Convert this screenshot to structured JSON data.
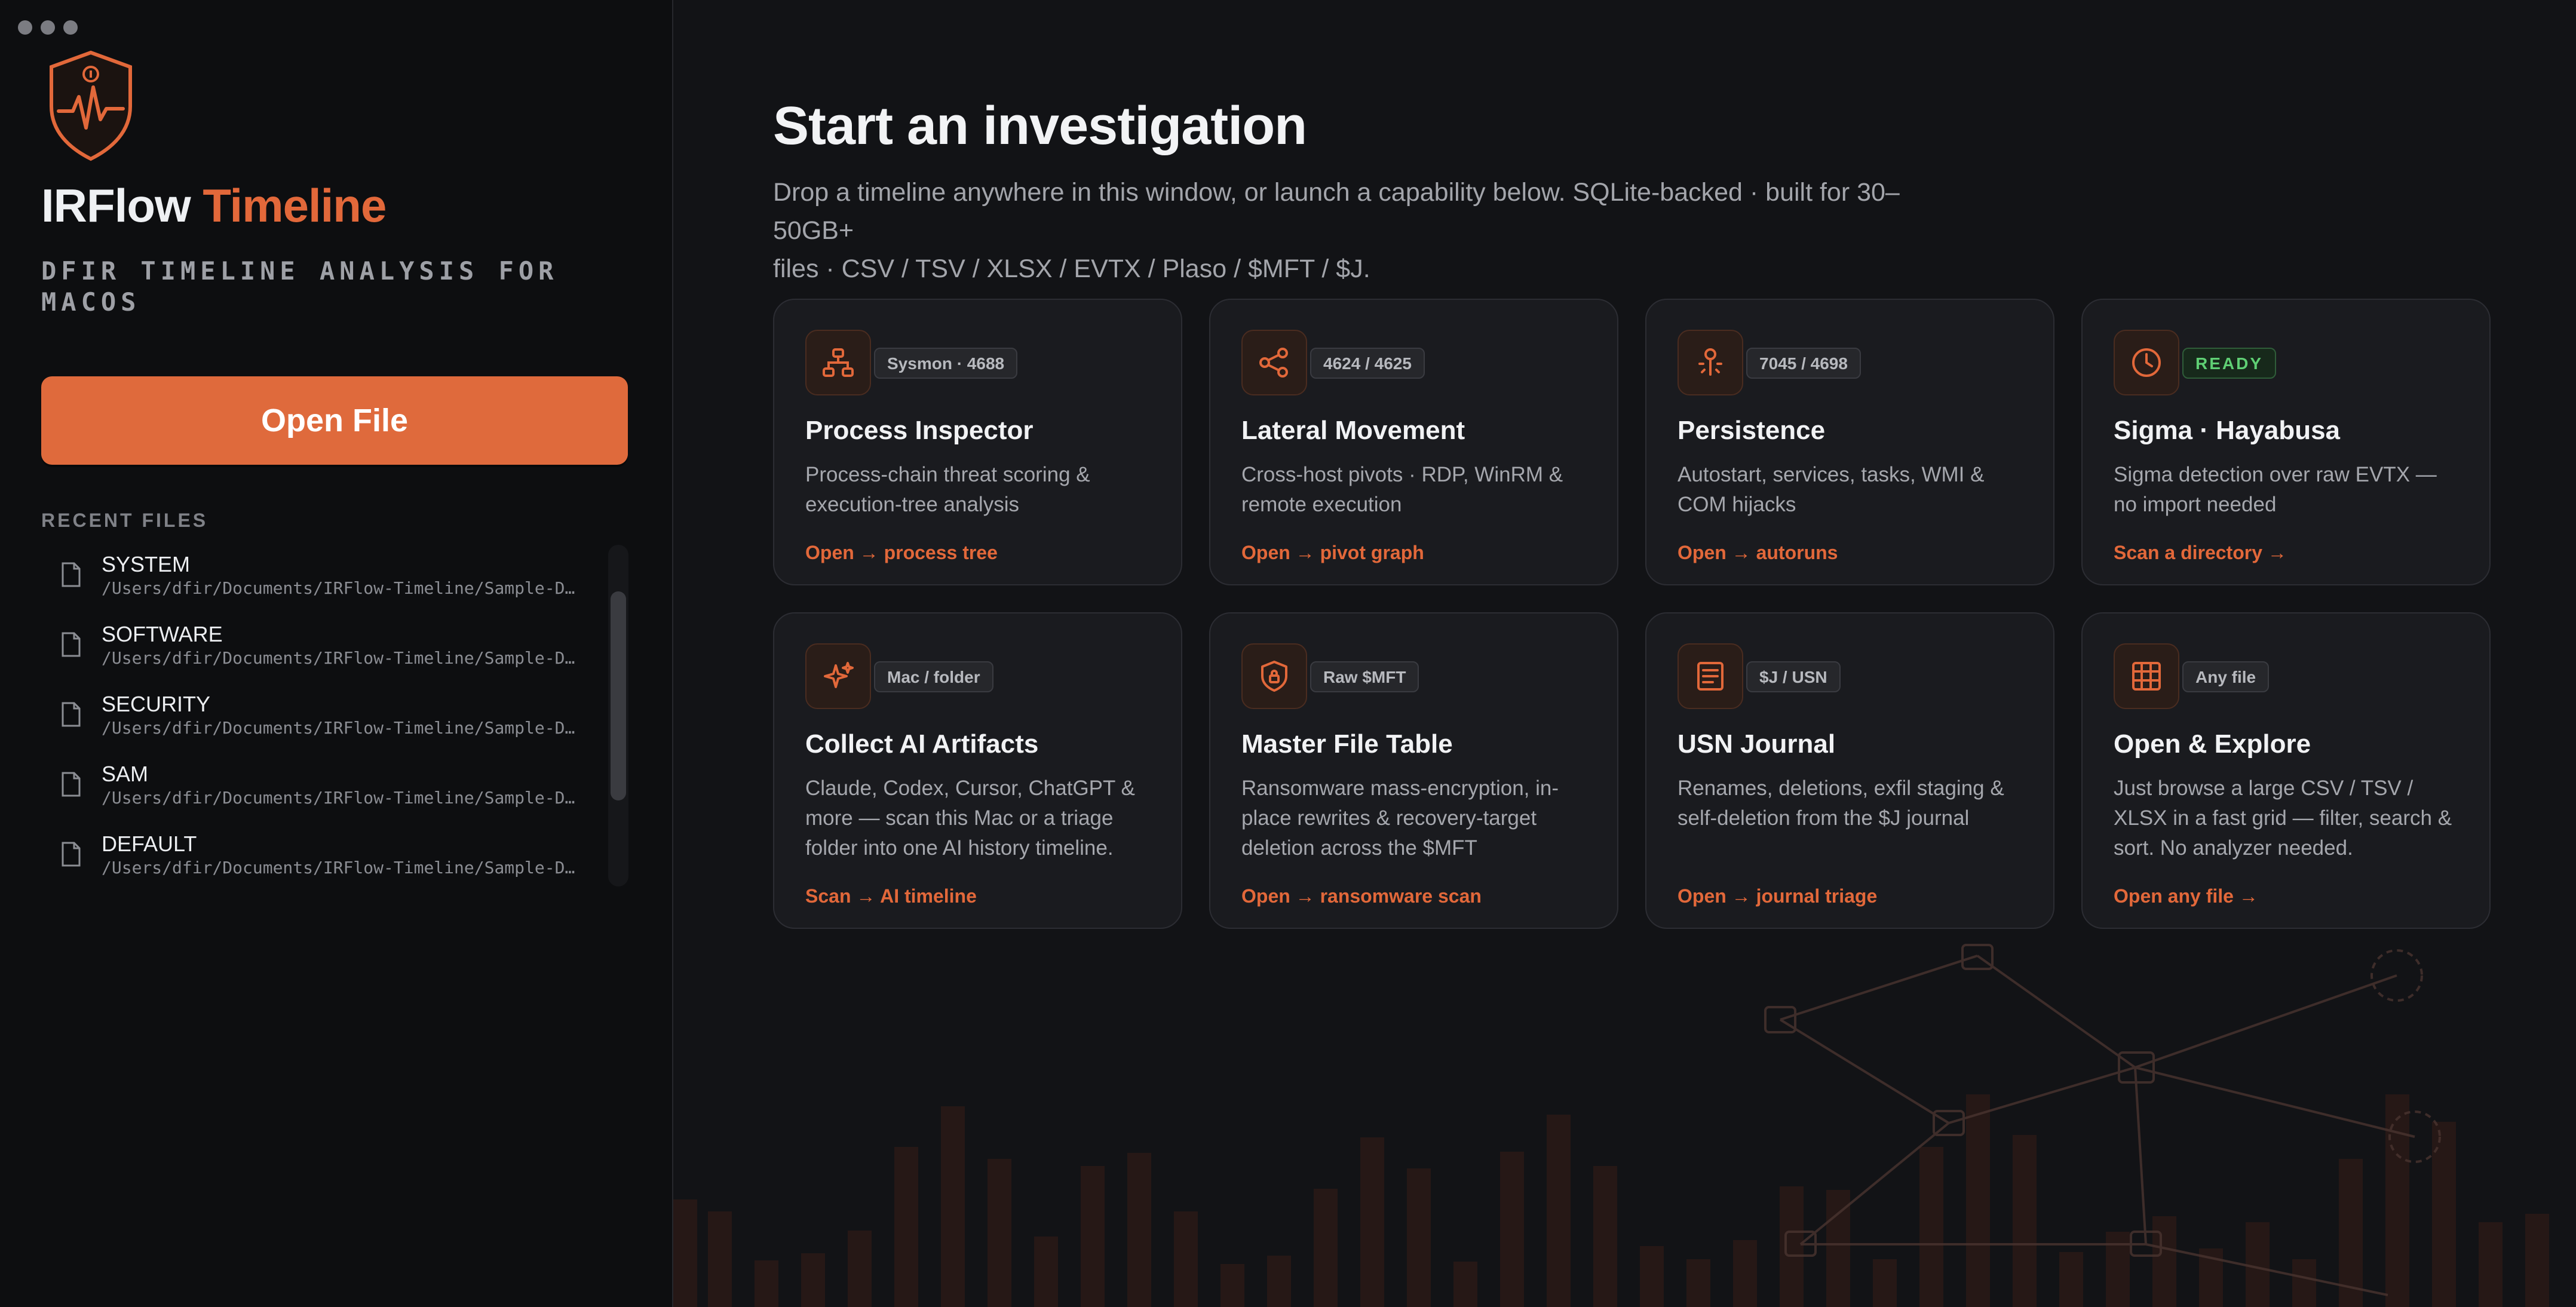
{
  "window": {
    "controls": [
      "close",
      "minimize",
      "zoom"
    ]
  },
  "sidebar": {
    "brand_part1": "IRFlow",
    "brand_part2": "Timeline",
    "tagline": "DFIR TIMELINE ANALYSIS FOR MACOS",
    "open_button": "Open File",
    "recent_label": "RECENT FILES",
    "recent_files": [
      {
        "name": "SYSTEM",
        "path": "/Users/dfir/Documents/IRFlow-Timeline/Sample-D…"
      },
      {
        "name": "SOFTWARE",
        "path": "/Users/dfir/Documents/IRFlow-Timeline/Sample-D…"
      },
      {
        "name": "SECURITY",
        "path": "/Users/dfir/Documents/IRFlow-Timeline/Sample-D…"
      },
      {
        "name": "SAM",
        "path": "/Users/dfir/Documents/IRFlow-Timeline/Sample-D…"
      },
      {
        "name": "DEFAULT",
        "path": "/Users/dfir/Documents/IRFlow-Timeline/Sample-D…"
      }
    ]
  },
  "main": {
    "headline": "Start an investigation",
    "intro_line1": "Drop a timeline anywhere in this window, or launch a capability below. SQLite-backed · built for 30–50GB+",
    "intro_line2": "files · CSV / TSV / XLSX / EVTX / Plaso / $MFT / $J.",
    "cards": [
      {
        "icon": "process-tree-icon",
        "badge": "Sysmon · 4688",
        "title": "Process Inspector",
        "desc": "Process-chain threat scoring & execution-tree analysis",
        "link": "Open → process tree"
      },
      {
        "icon": "share-nodes-icon",
        "badge": "4624 / 4625",
        "title": "Lateral Movement",
        "desc": "Cross-host pivots · RDP, WinRM & remote execution",
        "link": "Open → pivot graph"
      },
      {
        "icon": "anchor-pin-icon",
        "badge": "7045 / 4698",
        "title": "Persistence",
        "desc": "Autostart, services, tasks, WMI & COM hijacks",
        "link": "Open → autoruns"
      },
      {
        "icon": "clock-icon",
        "badge": "READY",
        "title": "Sigma · Hayabusa",
        "desc": "Sigma detection over raw EVTX — no import needed",
        "link": "Scan a directory →"
      },
      {
        "icon": "sparkle-icon",
        "badge": "Mac / folder",
        "title": "Collect AI Artifacts",
        "desc": "Claude, Codex, Cursor, ChatGPT & more — scan this Mac or a triage folder into one AI history timeline.",
        "link": "Scan → AI timeline"
      },
      {
        "icon": "shield-lock-icon",
        "badge": "Raw $MFT",
        "title": "Master File Table",
        "desc": "Ransomware mass-encryption, in-place rewrites & recovery-target deletion across the $MFT",
        "link": "Open → ransomware scan"
      },
      {
        "icon": "journal-icon",
        "badge": "$J / USN",
        "title": "USN Journal",
        "desc": "Renames, deletions, exfil staging & self-deletion from the $J journal",
        "link": "Open → journal triage"
      },
      {
        "icon": "table-grid-icon",
        "badge": "Any file",
        "title": "Open & Explore",
        "desc": "Just browse a large CSV / TSV / XLSX in a fast grid — filter, search & sort. No analyzer needed.",
        "link": "Open any file →"
      }
    ]
  },
  "colors": {
    "accent": "#e2683a",
    "ready": "#5fcf74",
    "background": "#121316",
    "sidebar": "#0d0e10",
    "card": "#1a1b1f"
  }
}
